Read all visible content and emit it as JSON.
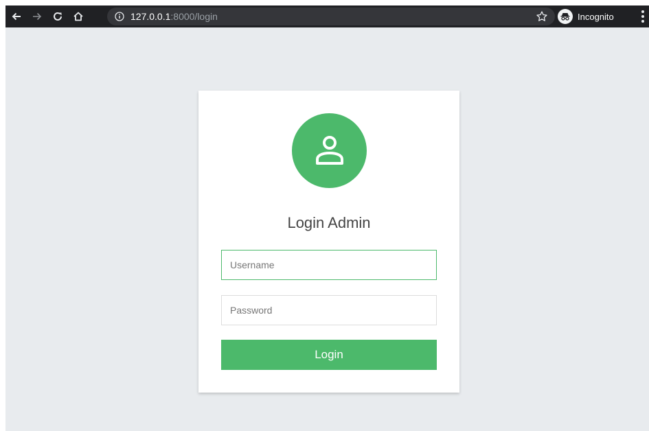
{
  "browser": {
    "url_host": "127.0.0.1",
    "url_path": ":8000/login",
    "incognito_label": "Incognito",
    "icons": {
      "back": "arrow-left-icon",
      "forward": "arrow-right-icon",
      "reload": "reload-icon",
      "home": "home-icon",
      "info": "info-icon",
      "bookmark": "star-icon",
      "incognito": "incognito-icon",
      "menu": "kebab-menu-icon"
    }
  },
  "login": {
    "title": "Login Admin",
    "username_placeholder": "Username",
    "password_placeholder": "Password",
    "button_label": "Login",
    "avatar_icon": "user-icon"
  },
  "colors": {
    "accent": "#4cb96b",
    "page_background": "#e8ebee",
    "toolbar": "#202124"
  }
}
